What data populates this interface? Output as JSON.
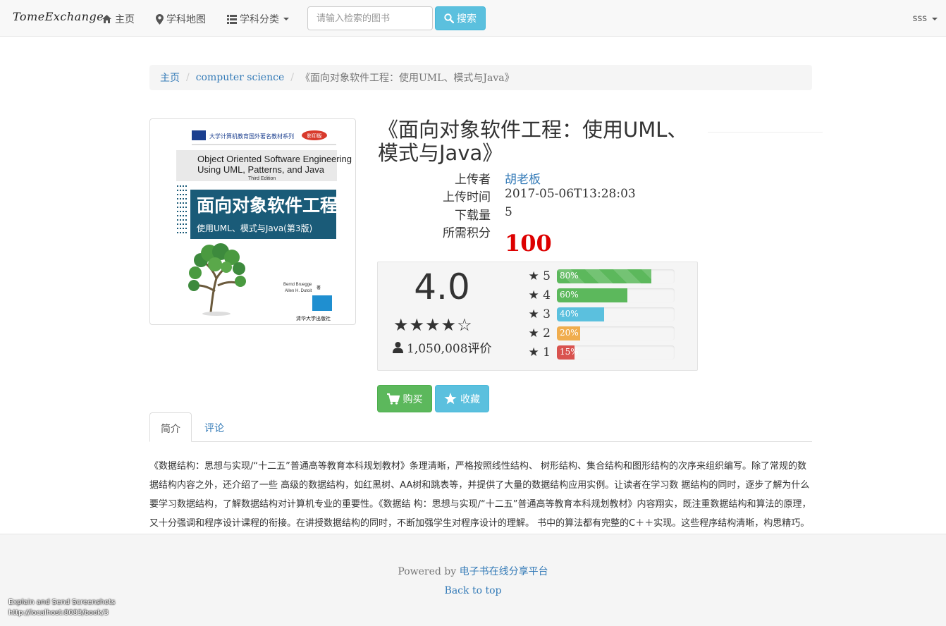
{
  "navbar": {
    "brand": "TomeExchange",
    "home": "主页",
    "subject_map": "学科地图",
    "subject_category": "学科分类",
    "search_placeholder": "请输入检索的图书",
    "search_button": "搜索",
    "user": "sss"
  },
  "breadcrumb": {
    "home": "主页",
    "category": "computer science",
    "current": "《面向对象软件工程：使用UML、模式与Java》"
  },
  "cover": {
    "series": "大学计算机教育国外著名教材系列",
    "badge": "影印版",
    "title_en_1": "Object Oriented Software Engineering",
    "title_en_2": "Using UML, Patterns, and Java",
    "edition": "Third Edition",
    "title_cn": "面向对象软件工程",
    "subtitle_cn": "使用UML、模式与Java(第3版)",
    "author1": "Bernd Bruegge",
    "author2": "Allen H. Dutoit",
    "author_mark": "著",
    "publisher": "清华大学出版社"
  },
  "book": {
    "title": "《面向对象软件工程：使用UML、模式与Java》",
    "uploader_label": "上传者",
    "uploader": "胡老板",
    "upload_time_label": "上传时间",
    "upload_time": "2017-05-06T13:28:03",
    "downloads_label": "下载量",
    "downloads": "5",
    "points_label": "所需积分",
    "points": "100"
  },
  "rating": {
    "score": "4.0",
    "stars": "★★★★☆",
    "count": "1,050,008评价",
    "bars": [
      {
        "label": "5",
        "percent": 80,
        "text": "80%",
        "color": "#5cb85c",
        "striped": true
      },
      {
        "label": "4",
        "percent": 60,
        "text": "60%",
        "color": "#5cb85c",
        "striped": false
      },
      {
        "label": "3",
        "percent": 40,
        "text": "40%",
        "color": "#5bc0de",
        "striped": false
      },
      {
        "label": "2",
        "percent": 20,
        "text": "20%",
        "color": "#f0ad4e",
        "striped": false
      },
      {
        "label": "1",
        "percent": 15,
        "text": "15%",
        "color": "#d9534f",
        "striped": false
      }
    ]
  },
  "actions": {
    "buy": "购买",
    "favorite": "收藏"
  },
  "tabs": {
    "intro": "简介",
    "comments": "评论"
  },
  "description": "《数据结构：思想与实现/“十二五”普通高等教育本科规划教材》条理清晰，严格按照线性结构、 树形结构、集合结构和图形结构的次序来组织编写。除了常规的数据结构内容之外，还介绍了一些 高级的数据结构，如红黑树、AA树和跳表等，并提供了大量的数据结构应用实例。让读者在学习数 据结构的同时，逐步了解为什么要学习数据结构，了解数据结构对计算机专业的重要性。《数据结 构：思想与实现/“十二五”普通高等教育本科规划教材》内容翔实，既注重数据结构和算法的原理， 又十分强调和程序设计课程的衔接。在讲授数据结构的同时，不断加强学生对程序设计的理解。 书中的算法都有完整的C＋＋实现。这些程序结构清晰，构思精巧。",
  "footer": {
    "powered_prefix": "Powered by ",
    "powered_link": "电子书在线分享平台",
    "back_to_top": "Back to top"
  },
  "overlay": {
    "line1": "Explain and Send Screenshots",
    "line2": "http://localhost:8083/book/3"
  }
}
